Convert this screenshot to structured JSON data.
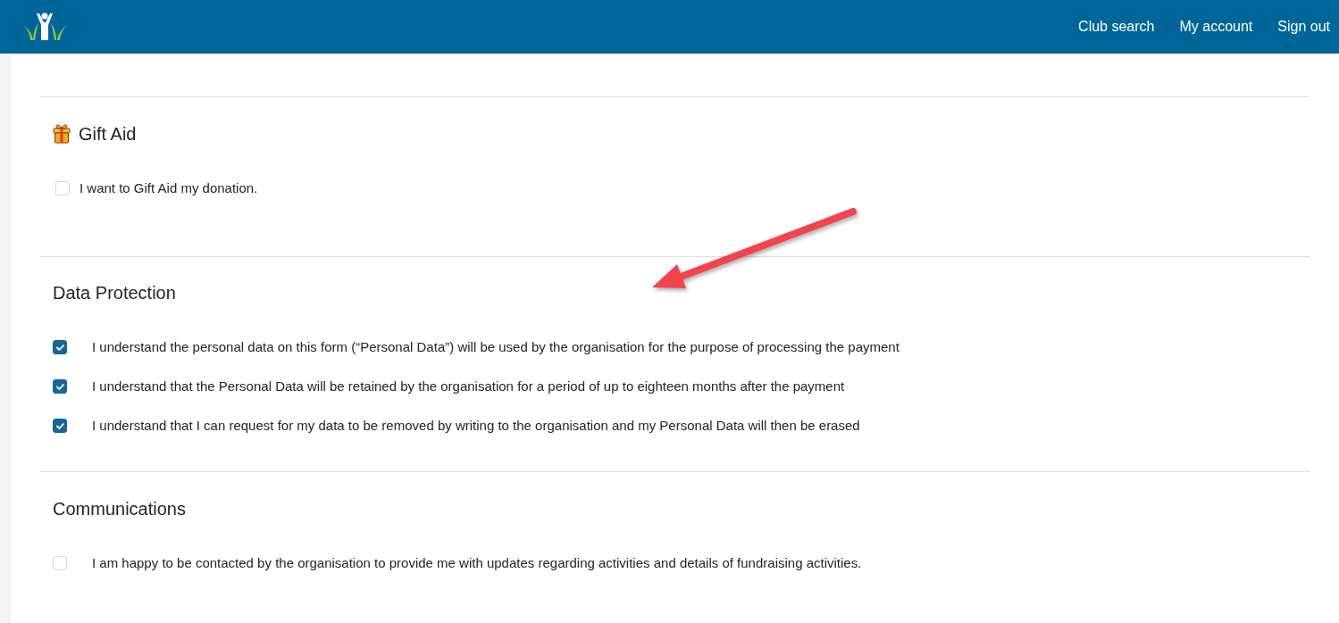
{
  "header": {
    "nav": [
      {
        "label": "Club search"
      },
      {
        "label": "My account"
      },
      {
        "label": "Sign out"
      }
    ]
  },
  "sections": [
    {
      "kind": "icon",
      "title": "Gift Aid",
      "items": [
        {
          "label": "I want to Gift Aid my donation.",
          "checked": false
        }
      ]
    },
    {
      "kind": "plain",
      "title": "Data Protection",
      "items": [
        {
          "label": "I understand the personal data on this form (“Personal Data”) will be used by the organisation for the purpose of processing the payment",
          "checked": true
        },
        {
          "label": "I understand that the Personal Data will be retained by the organisation for a period of up to eighteen months after the payment",
          "checked": true
        },
        {
          "label": "I understand that I can request for my data to be removed by writing to the organisation and my Personal Data will then be erased",
          "checked": true
        }
      ]
    },
    {
      "kind": "plain",
      "title": "Communications",
      "items": [
        {
          "label": "I am happy to be contacted by the organisation to provide me with updates regarding activities and details of fundraising activities.",
          "checked": false
        }
      ]
    }
  ]
}
